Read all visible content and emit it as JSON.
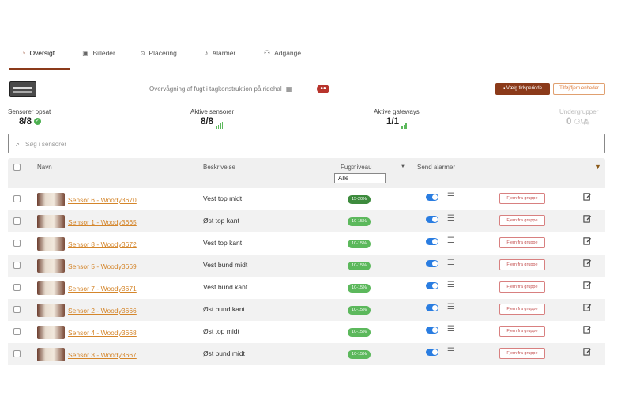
{
  "tabs": [
    {
      "label": "Oversigt",
      "icon": "gauge-icon",
      "active": true
    },
    {
      "label": "Billeder",
      "icon": "images-icon",
      "active": false
    },
    {
      "label": "Placering",
      "icon": "person-pin-icon",
      "active": false
    },
    {
      "label": "Alarmer",
      "icon": "bell-icon",
      "active": false
    },
    {
      "label": "Adgange",
      "icon": "users-icon",
      "active": false
    }
  ],
  "header": {
    "description": "Overvågning af fugt i tagkonstruktion på ridehal",
    "btn_period": "Vælg tidsperiode",
    "btn_units": "Tilføj/fjern enheder"
  },
  "stats": {
    "sensors": {
      "label": "Sensorer opsat",
      "value": "8/8"
    },
    "active_sensors": {
      "label": "Aktive sensorer",
      "value": "8/8"
    },
    "active_gateways": {
      "label": "Aktive gateways",
      "value": "1/1"
    },
    "subgroups": {
      "label": "Undergrupper",
      "value": "0"
    }
  },
  "search": {
    "placeholder": "Søg i sensorer"
  },
  "table": {
    "headers": {
      "name": "Navn",
      "description": "Beskrivelse",
      "humidity": "Fugtniveau",
      "alarms": "Send alarmer"
    },
    "filter_value": "Alle",
    "rows": [
      {
        "name": "Sensor 6 - Woody3670",
        "description": "Vest top midt",
        "level": "15-20%",
        "remove": "Fjern fra gruppe",
        "alarm_on": true
      },
      {
        "name": "Sensor 1 - Woody3665",
        "description": "Øst top kant",
        "level": "10-15%",
        "remove": "Fjern fra gruppe",
        "alarm_on": true
      },
      {
        "name": "Sensor 8 - Woody3672",
        "description": "Vest top kant",
        "level": "10-15%",
        "remove": "Fjern fra gruppe",
        "alarm_on": true
      },
      {
        "name": "Sensor 5 - Woody3669",
        "description": "Vest bund midt",
        "level": "10-15%",
        "remove": "Fjern fra gruppe",
        "alarm_on": true
      },
      {
        "name": "Sensor 7 - Woody3671",
        "description": "Vest bund kant",
        "level": "10-15%",
        "remove": "Fjern fra gruppe",
        "alarm_on": true
      },
      {
        "name": "Sensor 2 - Woody3666",
        "description": "Øst bund kant",
        "level": "10-15%",
        "remove": "Fjern fra gruppe",
        "alarm_on": true
      },
      {
        "name": "Sensor 4 - Woody3668",
        "description": "Øst top midt",
        "level": "10-15%",
        "remove": "Fjern fra gruppe",
        "alarm_on": true
      },
      {
        "name": "Sensor 3 - Woody3667",
        "description": "Øst bund midt",
        "level": "10-15%",
        "remove": "Fjern fra gruppe",
        "alarm_on": true
      }
    ]
  },
  "colors": {
    "brand": "#8b3a1a",
    "link": "#d4852a",
    "level_high": "#3d8b3d",
    "level_normal": "#5cb85c",
    "toggle_on": "#2a7de1"
  }
}
